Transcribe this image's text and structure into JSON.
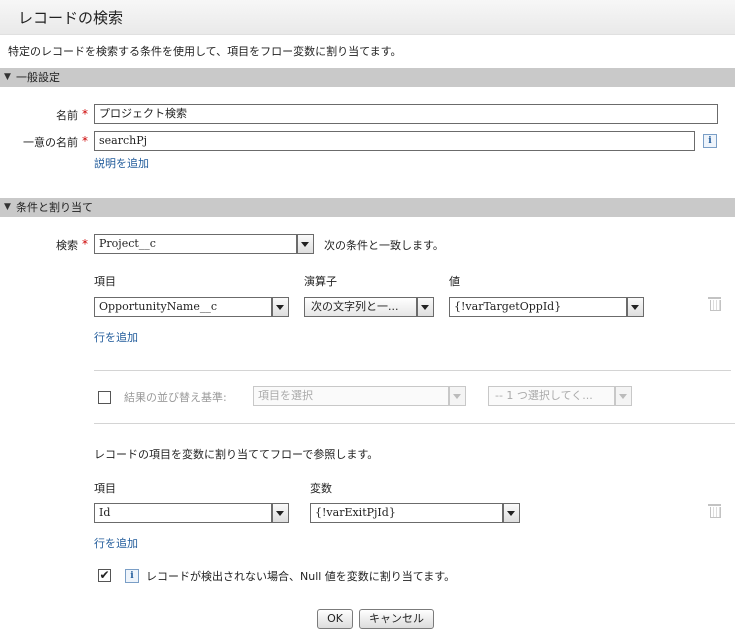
{
  "header": {
    "title": "レコードの検索"
  },
  "description": "特定のレコードを検索する条件を使用して、項目をフロー変数に割り当てます。",
  "general": {
    "section_title": "一般設定",
    "name_label": "名前",
    "name_value": "プロジェクト検索",
    "unique_name_label": "一意の名前",
    "unique_name_value": "searchPj",
    "add_description_link": "説明を追加",
    "required_marker": "*",
    "info_glyph": "i"
  },
  "criteria": {
    "section_title": "条件と割り当て",
    "search_label": "検索",
    "search_object": "Project__c",
    "match_text": "次の条件と一致します。",
    "filter_headers": {
      "field": "項目",
      "operator": "演算子",
      "value": "値"
    },
    "filter_rows": [
      {
        "field": "OpportunityName__c",
        "operator": "次の文字列と一...",
        "value": "{!varTargetOppId}"
      }
    ],
    "add_row_link": "行を追加"
  },
  "sort": {
    "label": "結果の並び替え基準:",
    "field_placeholder": "項目を選択",
    "order_placeholder": "-- 1 つ選択してく..."
  },
  "assignment": {
    "intro": "レコードの項目を変数に割り当ててフローで参照します。",
    "headers": {
      "field": "項目",
      "variable": "変数"
    },
    "rows": [
      {
        "field": "Id",
        "variable": "{!varExitPjId}"
      }
    ],
    "add_row_link": "行を追加",
    "null_option_label": "レコードが検出されない場合、Null 値を変数に割り当てます。",
    "null_option_checked": true
  },
  "footer": {
    "ok_label": "OK",
    "cancel_label": "キャンセル"
  },
  "icons": {
    "collapse": "▼",
    "check": "✔"
  }
}
